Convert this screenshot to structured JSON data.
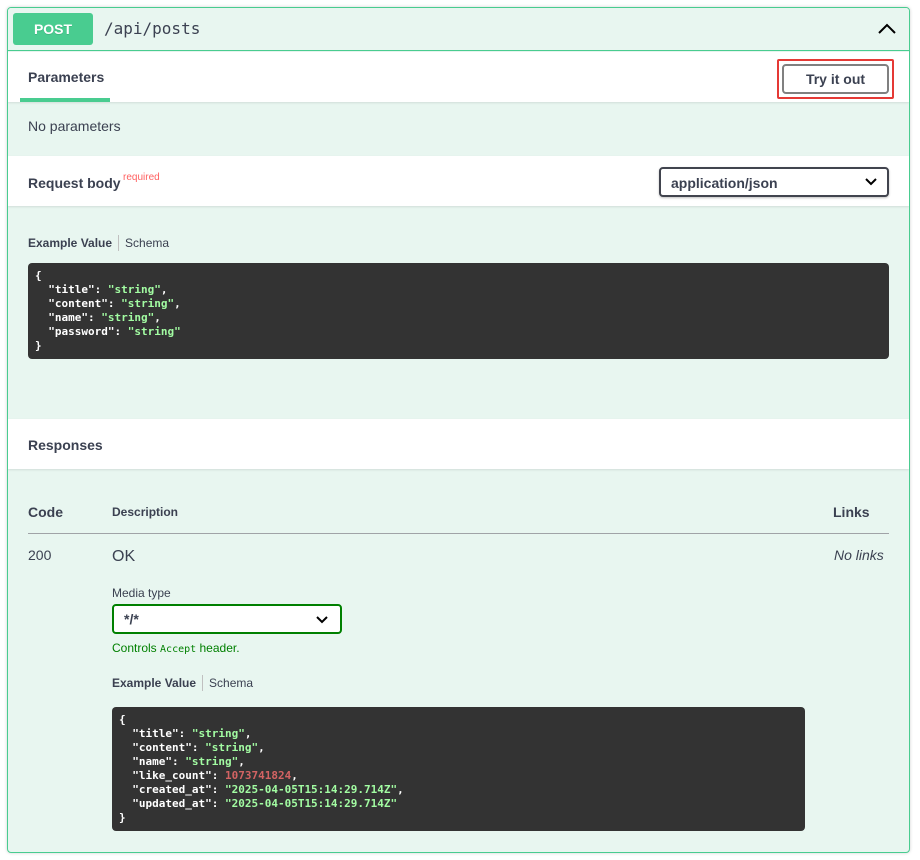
{
  "summary": {
    "method": "POST",
    "path": "/api/posts"
  },
  "parameters": {
    "tab_label": "Parameters",
    "try_button_label": "Try it out",
    "empty_text": "No parameters"
  },
  "request_body": {
    "title": "Request body",
    "required_label": "required",
    "content_type": "application/json",
    "example_tab": "Example Value",
    "schema_tab": "Schema",
    "example_lines": [
      {
        "key": "title",
        "value": "\"string\"",
        "type": "str"
      },
      {
        "key": "content",
        "value": "\"string\"",
        "type": "str"
      },
      {
        "key": "name",
        "value": "\"string\"",
        "type": "str"
      },
      {
        "key": "password",
        "value": "\"string\"",
        "type": "str"
      }
    ]
  },
  "responses": {
    "title": "Responses",
    "col_code": "Code",
    "col_description": "Description",
    "col_links": "Links",
    "rows": [
      {
        "code": "200",
        "description": "OK",
        "links": "No links",
        "media_type_label": "Media type",
        "media_type_value": "*/*",
        "controls_prefix": "Controls",
        "controls_code": "Accept",
        "controls_suffix": "header.",
        "example_tab": "Example Value",
        "schema_tab": "Schema",
        "example_lines": [
          {
            "key": "title",
            "value": "\"string\"",
            "type": "str"
          },
          {
            "key": "content",
            "value": "\"string\"",
            "type": "str"
          },
          {
            "key": "name",
            "value": "\"string\"",
            "type": "str"
          },
          {
            "key": "like_count",
            "value": "1073741824",
            "type": "num"
          },
          {
            "key": "created_at",
            "value": "\"2025-04-05T15:14:29.714Z\"",
            "type": "str"
          },
          {
            "key": "updated_at",
            "value": "\"2025-04-05T15:14:29.714Z\"",
            "type": "str"
          }
        ]
      }
    ]
  },
  "colors": {
    "post_green": "#49cc90",
    "highlight_red": "#e53935",
    "code_bg": "#333333",
    "string_green": "#a2fca2",
    "number_red": "#d36363"
  }
}
